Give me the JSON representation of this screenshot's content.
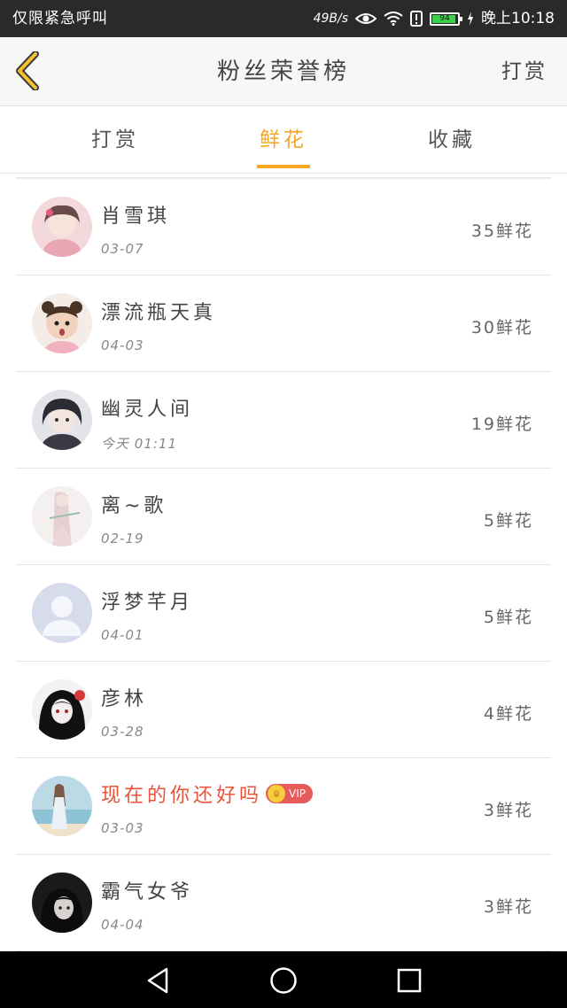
{
  "status_bar": {
    "left_text": "仅限紧急呼叫",
    "net_speed": "49B/s",
    "battery": "94",
    "battery_level": 0.94,
    "time": "晚上10:18"
  },
  "header": {
    "title": "粉丝荣誉榜",
    "action": "打赏"
  },
  "tabs": [
    {
      "label": "打赏",
      "active": false
    },
    {
      "label": "鲜花",
      "active": true
    },
    {
      "label": "收藏",
      "active": false
    }
  ],
  "fans": [
    {
      "name": "肖雪琪",
      "date": "03-07",
      "count": "35鲜花"
    },
    {
      "name": "漂流瓶天真",
      "date": "04-03",
      "count": "30鲜花"
    },
    {
      "name": "幽灵人间",
      "date": "今天 01:11",
      "count": "19鲜花"
    },
    {
      "name": "离~歌",
      "date": "02-19",
      "count": "5鲜花"
    },
    {
      "name": "浮梦芊月",
      "date": "04-01",
      "count": "5鲜花"
    },
    {
      "name": "彦林",
      "date": "03-28",
      "count": "4鲜花"
    },
    {
      "name": "现在的你还好吗",
      "date": "03-03",
      "count": "3鲜花",
      "vip_label": "VIP"
    },
    {
      "name": "霸气女爷",
      "date": "04-04",
      "count": "3鲜花"
    }
  ],
  "colors": {
    "accent": "#f5a623",
    "vip_name": "#e8533a",
    "vip_badge": "#e65a5a"
  }
}
